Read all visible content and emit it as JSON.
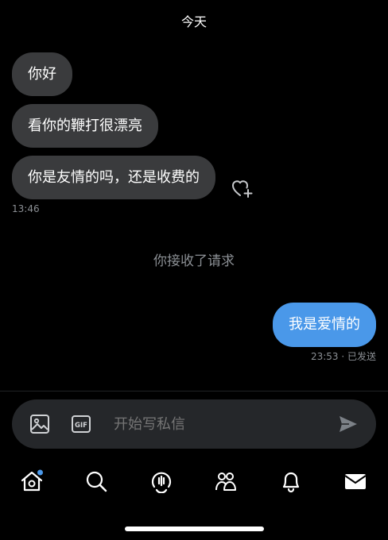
{
  "colors": {
    "background": "#000000",
    "incoming_bubble": "#3a3b3d",
    "outgoing_bubble": "#4a98e9",
    "muted_text": "#8b8f94",
    "notification_dot": "#4a98e9"
  },
  "header": {
    "date_label": "今天"
  },
  "messages": {
    "incoming": [
      {
        "text": "你好"
      },
      {
        "text": "看你的鞭打很漂亮"
      },
      {
        "text": "你是友情的吗，还是收费的"
      }
    ],
    "incoming_time": "13:46",
    "system_notice": "你接收了请求",
    "outgoing": [
      {
        "text": "我是爱情的"
      }
    ],
    "outgoing_status": "23:53 · 已发送"
  },
  "composer": {
    "placeholder": "开始写私信",
    "icons": [
      "image-icon",
      "gif-icon",
      "send-icon"
    ]
  },
  "tabbar": {
    "items": [
      {
        "icon": "home-icon",
        "has_dot": true
      },
      {
        "icon": "search-icon"
      },
      {
        "icon": "spaces-icon"
      },
      {
        "icon": "communities-icon"
      },
      {
        "icon": "bell-icon"
      },
      {
        "icon": "mail-icon",
        "active": true
      }
    ]
  }
}
